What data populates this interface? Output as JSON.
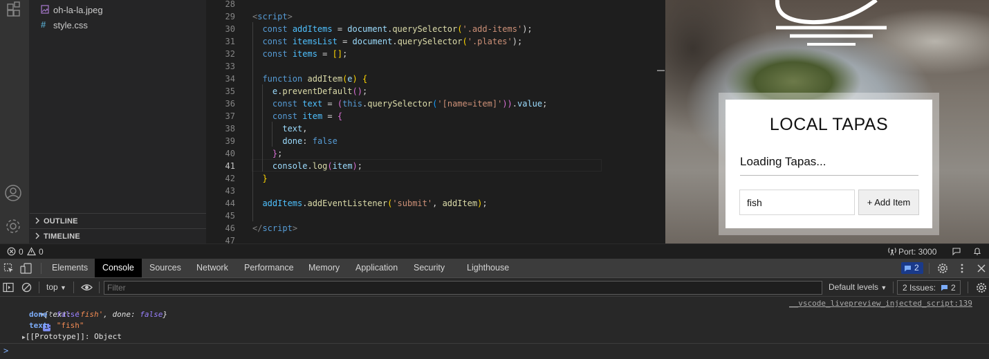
{
  "explorer": {
    "files": [
      {
        "name": "oh-la-la.jpeg",
        "icon": "image-file-icon"
      },
      {
        "name": "style.css",
        "icon": "css-file-icon"
      }
    ],
    "sections": [
      {
        "label": "OUTLINE"
      },
      {
        "label": "TIMELINE"
      }
    ]
  },
  "editor": {
    "active_line": "41",
    "lines": [
      {
        "n": "28"
      },
      {
        "n": "29"
      },
      {
        "n": "30"
      },
      {
        "n": "31"
      },
      {
        "n": "32"
      },
      {
        "n": "33"
      },
      {
        "n": "34"
      },
      {
        "n": "35"
      },
      {
        "n": "36"
      },
      {
        "n": "37"
      },
      {
        "n": "38"
      },
      {
        "n": "39"
      },
      {
        "n": "40"
      },
      {
        "n": "41"
      },
      {
        "n": "42"
      },
      {
        "n": "43"
      },
      {
        "n": "44"
      },
      {
        "n": "45"
      },
      {
        "n": "46"
      },
      {
        "n": "47"
      }
    ],
    "code": {
      "l29": {
        "open": "<",
        "tag": "script",
        "close": ">"
      },
      "l30": {
        "kw": "const",
        "var": "addItems",
        "eq": " = ",
        "obj": "document",
        "dot": ".",
        "fn": "querySelector",
        "p1": "(",
        "str": "'.add-items'",
        "p2": ");"
      },
      "l31": {
        "kw": "const",
        "var": "itemsList",
        "eq": " = ",
        "obj": "document",
        "dot": ".",
        "fn": "querySelector",
        "p1": "(",
        "str": "'.plates'",
        "p2": ");"
      },
      "l32": {
        "kw": "const",
        "var": "items",
        "eq": " = ",
        "br": "[]",
        "end": ";"
      },
      "l34": {
        "kw": "function",
        "fn": "addItem",
        "p1": "(",
        "arg": "e",
        "p2": ")",
        "brace": "{"
      },
      "l35": {
        "obj": "e",
        "dot": ".",
        "fn": "preventDefault",
        "p": "()",
        "end": ";"
      },
      "l36": {
        "kw": "const",
        "var": "text",
        "eq": " = ",
        "p1": "(",
        "this": "this",
        "dot": ".",
        "fn": "querySelector",
        "p2": "(",
        "str": "'[name=item]'",
        "p3": "))",
        "dot2": ".",
        "prop": "value",
        "end": ";"
      },
      "l37": {
        "kw": "const",
        "var": "item",
        "eq": " = ",
        "brace": "{"
      },
      "l38": {
        "prop": "text",
        "end": ","
      },
      "l39": {
        "prop": "done",
        "colon": ": ",
        "val": "false"
      },
      "l40": {
        "brace": "}",
        "end": ";"
      },
      "l41": {
        "obj": "console",
        "dot": ".",
        "fn": "log",
        "p1": "(",
        "arg": "item",
        "p2": ")",
        "end": ";"
      },
      "l42": {
        "brace": "}"
      },
      "l44": {
        "obj": "addItems",
        "dot": ".",
        "fn": "addEventListener",
        "p1": "(",
        "str": "'submit'",
        "comma": ", ",
        "arg": "addItem",
        "p2": ")",
        "end": ";"
      },
      "l46": {
        "open": "</",
        "tag": "script",
        "close": ">"
      }
    }
  },
  "preview": {
    "title": "LOCAL TAPAS",
    "subtitle": "Loading Tapas...",
    "input_value": "fish",
    "button_label": "+ Add Item"
  },
  "statusbar": {
    "errors": "0",
    "warnings": "0",
    "port": "Port: 3000"
  },
  "devtools": {
    "tabs": [
      "Elements",
      "Console",
      "Sources",
      "Network",
      "Performance",
      "Memory",
      "Application",
      "Security",
      "Lighthouse"
    ],
    "active_tab": "Console",
    "message_badge": "2",
    "context": "top",
    "filter_placeholder": "Filter",
    "levels": "Default levels",
    "issues_label": "2 Issues:",
    "issues_count": "2",
    "console": {
      "summary_open": "{",
      "summary_k1": "text",
      "summary_v1": "'fish'",
      "summary_sep": ", ",
      "summary_k2": "done",
      "summary_v2": "false",
      "summary_close": "}",
      "info_badge": "i",
      "source": "__vscode_livepreview_injected_script:139",
      "props": [
        {
          "key": "done",
          "value": "false"
        },
        {
          "key": "text",
          "value": "\"fish\""
        }
      ],
      "proto_key": "[[Prototype]]",
      "proto_value": "Object",
      "prompt": ">"
    }
  },
  "colors": {
    "editor_bg": "#1e1e1e",
    "sidebar_bg": "#252526",
    "activity_bg": "#333333",
    "accent_blue": "#1a3a8a"
  }
}
